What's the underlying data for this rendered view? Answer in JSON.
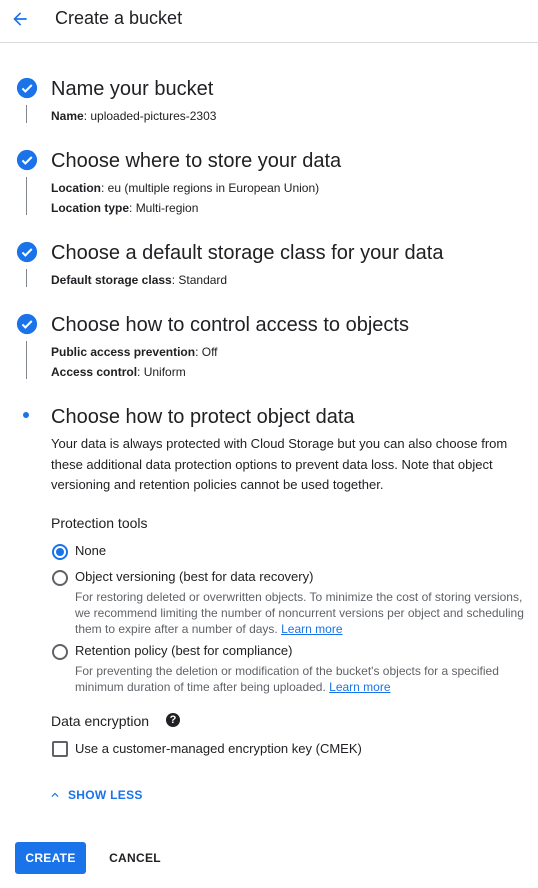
{
  "header": {
    "title": "Create a bucket",
    "back_icon": "arrow-back-icon"
  },
  "steps": [
    {
      "heading": "Name your bucket",
      "status": "complete",
      "summary": [
        {
          "key": "Name",
          "value": "uploaded-pictures-2303"
        }
      ]
    },
    {
      "heading": "Choose where to store your data",
      "status": "complete",
      "summary": [
        {
          "key": "Location",
          "value": "eu (multiple regions in European Union)"
        },
        {
          "key": "Location type",
          "value": "Multi-region"
        }
      ]
    },
    {
      "heading": "Choose a default storage class for your data",
      "status": "complete",
      "summary": [
        {
          "key": "Default storage class",
          "value": "Standard"
        }
      ]
    },
    {
      "heading": "Choose how to control access to objects",
      "status": "complete",
      "summary": [
        {
          "key": "Public access prevention",
          "value": "Off"
        },
        {
          "key": "Access control",
          "value": "Uniform"
        }
      ]
    },
    {
      "heading": "Choose how to protect object data",
      "status": "active",
      "description": "Your data is always protected with Cloud Storage but you can also choose from these additional data protection options to prevent data loss. Note that object versioning and retention policies cannot be used together."
    }
  ],
  "protection_tools": {
    "title": "Protection tools",
    "options": [
      {
        "label": "None",
        "checked": true
      },
      {
        "label": "Object versioning (best for data recovery)",
        "checked": false,
        "help": "For restoring deleted or overwritten objects. To minimize the cost of storing versions, we recommend limiting the number of noncurrent versions per object and scheduling them to expire after a number of days.",
        "link": "Learn more"
      },
      {
        "label": "Retention policy (best for compliance)",
        "checked": false,
        "help": "For preventing the deletion or modification of the bucket's objects for a specified minimum duration of time after being uploaded.",
        "link": "Learn more"
      }
    ]
  },
  "data_encryption": {
    "title": "Data encryption",
    "help_icon": "help-icon",
    "cmek_label": "Use a customer-managed encryption key (CMEK)",
    "cmek_checked": false
  },
  "show_less_label": "SHOW LESS",
  "actions": {
    "create": "CREATE",
    "cancel": "CANCEL"
  },
  "colors": {
    "accent": "#1a73e8",
    "text": "#202124",
    "muted": "#5f6368",
    "divider": "#dadce0"
  }
}
